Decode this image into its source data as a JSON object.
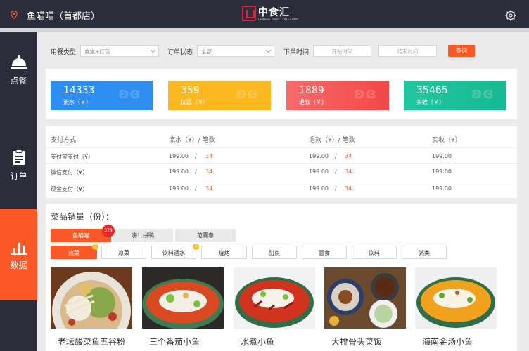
{
  "header": {
    "store_name": "鱼喵喵（首都店）",
    "logo_cn": "中食汇",
    "logo_en": "CHINESE FOOD COLLECTION"
  },
  "sidebar": {
    "items": [
      {
        "label": "点餐",
        "icon": "cloche-icon"
      },
      {
        "label": "订单",
        "icon": "clipboard-icon"
      },
      {
        "label": "数据",
        "icon": "bar-chart-icon",
        "active": true
      }
    ]
  },
  "filters": {
    "meal_type_label": "用餐类型",
    "meal_type_value": "食堂+打包",
    "order_status_label": "订单状态",
    "order_status_value": "全部",
    "time_label": "下单时间",
    "start_placeholder": "开始时间",
    "end_placeholder": "结束时间",
    "query_label": "查询"
  },
  "stats": [
    {
      "value": "14333",
      "caption": "流水（￥）",
      "color": "#2e8ef0"
    },
    {
      "value": "359",
      "caption": "优惠（￥）",
      "color": "#fbb820"
    },
    {
      "value": "1889",
      "caption": "退款（￥）",
      "color": "#f55353"
    },
    {
      "value": "35465",
      "caption": "实收（￥）",
      "color": "#1ec49c"
    }
  ],
  "payments": {
    "headers": [
      "支付方式",
      "流水（¥）/ 笔数",
      "退款（¥）/ 笔数",
      "实收（¥）"
    ],
    "rows": [
      {
        "method": "支付宝支付（¥）",
        "flow": "199.00",
        "flow_count": "34",
        "refund": "199.00",
        "refund_count": "34",
        "net": "199.00"
      },
      {
        "method": "微信支付（¥）",
        "flow": "199.00",
        "flow_count": "34",
        "refund": "199.00",
        "refund_count": "34",
        "net": "199.00"
      },
      {
        "method": "现金支付（¥）",
        "flow": "199.00",
        "flow_count": "34",
        "refund": "199.00",
        "refund_count": "34",
        "net": "199.00"
      }
    ],
    "slash": "/"
  },
  "sales": {
    "title": "菜品销量（份）：",
    "stores": [
      "鱼喵喵",
      "嗨！拼鸭",
      "范青春"
    ],
    "store_badge": "378",
    "categories": [
      "热菜",
      "凉菜",
      "饮料酒水",
      "烧烤",
      "甜点",
      "面食",
      "饮料",
      "粥类"
    ],
    "category_badges": [
      "2",
      "2"
    ],
    "dishes": [
      "老坛酸菜鱼五谷粉",
      "三个番茄小鱼",
      "水煮小鱼",
      "大排骨头菜饭",
      "海南金汤小鱼"
    ]
  },
  "colors": {
    "accent": "#fb5a28",
    "sidebar_bg": "#2b2d3a",
    "badge_red": "#e52a2a",
    "badge_yellow": "#f4c430"
  }
}
